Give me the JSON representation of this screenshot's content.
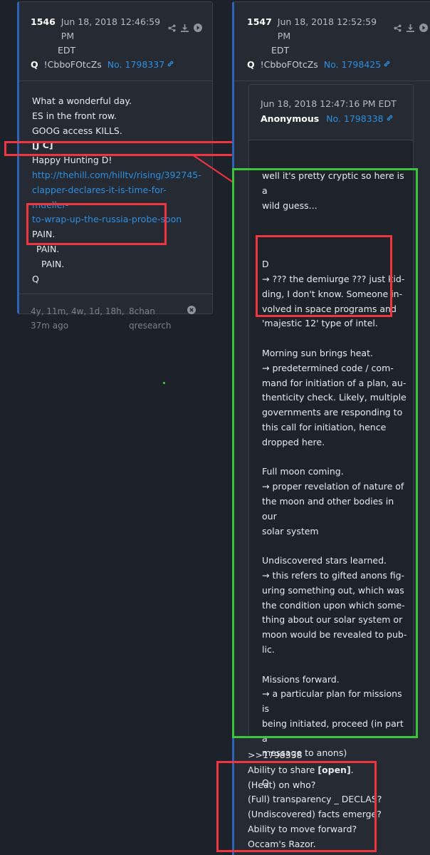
{
  "post1": {
    "number": "1546",
    "date": "Jun 18, 2018 12:46:59 PM",
    "date_tz": "EDT",
    "q": "Q",
    "trip": "!CbboFOtcZs",
    "ref": "No. 1798337",
    "lines": [
      "What a wonderful day.",
      "ES in the front row.",
      "GOOG access KILLS.",
      "[J C]",
      "Happy Hunting D!"
    ],
    "url_lines": [
      "http://thehill.com/hilltv/rising/392745-",
      "clapper-declares-it-is-time-for-mueller-",
      "to-wrap-up-the-russia-probe-soon"
    ],
    "pain": [
      "PAIN.",
      "PAIN.",
      "PAIN."
    ],
    "sig": "Q",
    "age_1": "4y, 11m, 4w, 1d, 18h,",
    "age_2": "37m ago",
    "board_1": "8chan",
    "board_2": "qresearch",
    "close": "⊗"
  },
  "post2": {
    "number": "1547",
    "date": "Jun 18, 2018 12:52:59 PM",
    "date_tz": "EDT",
    "q": "Q",
    "trip": "!CbboFOtcZs",
    "ref": "No. 1798425",
    "quoted": {
      "date": "Jun 18, 2018 12:47:16 PM EDT",
      "author": "Anonymous",
      "ref": "No. 1798338",
      "p1": [
        "well it's pretty cryptic so here is a",
        "wild guess..."
      ],
      "p2": [
        "D",
        "→ ??? the demiurge ??? just kid-",
        "ding, I don't know.  Someone in-",
        "volved in space programs and",
        "'majestic 12' type of intel."
      ],
      "p3": [
        "Morning sun brings heat.",
        "→ predetermined code / com-",
        "mand for initiation of a plan, au-",
        "thenticity check.  Likely, multiple",
        "governments are responding to",
        "this call for initiation, hence",
        "dropped here."
      ],
      "p4": [
        "Full moon coming.",
        "→ proper revelation of nature of",
        "the moon and other bodies in our",
        "solar system"
      ],
      "p5": [
        "Undiscovered stars learned.",
        "→ this refers to gifted anons fig-",
        "uring something out, which was",
        "the condition upon which some-",
        "thing about our solar system or",
        "moon would be revealed to pub-",
        "lic."
      ],
      "p6": [
        "Missions forward.",
        "→ a particular plan for missions is",
        "being initiated, proceed (in part a",
        "message to anons)"
      ],
      "sig": "Q"
    },
    "reply_ref": ">>1798338",
    "reply_share_prefix": "Ability to share ",
    "reply_share_bold": "[open]",
    "reply_share_suffix": ".",
    "reply_lines": [
      "(Heat) on who?",
      "(Full) transparency _ DECLAS?",
      "(Undiscovered) facts emerge?",
      "Ability to move forward?",
      "Occam's Razor."
    ]
  },
  "colors": {
    "background": "#1d2129",
    "link": "#2e8fe0",
    "highlight_red": "#ee3540",
    "highlight_green": "#3cc43c"
  }
}
